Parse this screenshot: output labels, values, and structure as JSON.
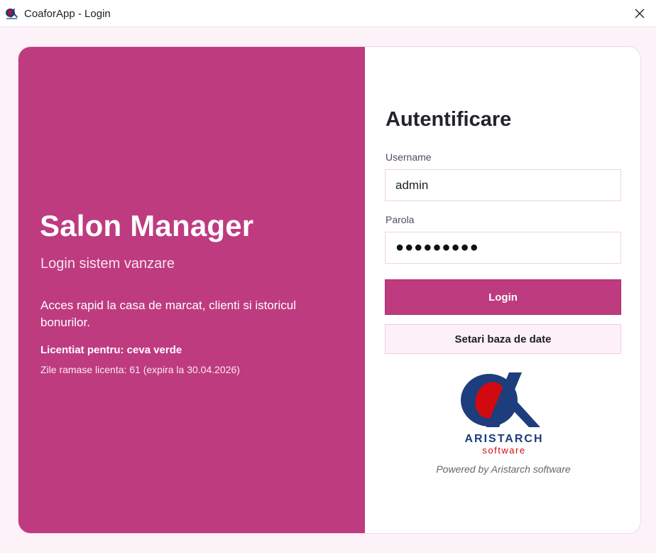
{
  "window": {
    "title": "CoaforApp - Login",
    "icon": "aristarch-alpha-icon"
  },
  "left_panel": {
    "app_name": "Salon Manager",
    "subtitle": "Login sistem vanzare",
    "description": "Acces rapid la casa de marcat, clienti si istoricul bonurilor.",
    "license": "Licentiat pentru: ceva verde",
    "days_left": "Zile ramase licenta: 61 (expira la 30.04.2026)",
    "background_color": "#be3b80"
  },
  "form": {
    "title": "Autentificare",
    "username_label": "Username",
    "username_value": "admin",
    "password_label": "Parola",
    "password_mask": "●●●●●●●●●",
    "login_button": "Login",
    "settings_button": "Setari baza de date"
  },
  "branding": {
    "logo_name": "ARISTARCH",
    "logo_tagline": "software",
    "powered_by": "Powered by Aristarch software",
    "logo_colors": {
      "navy": "#1d3d7c",
      "red": "#d10a11"
    }
  }
}
